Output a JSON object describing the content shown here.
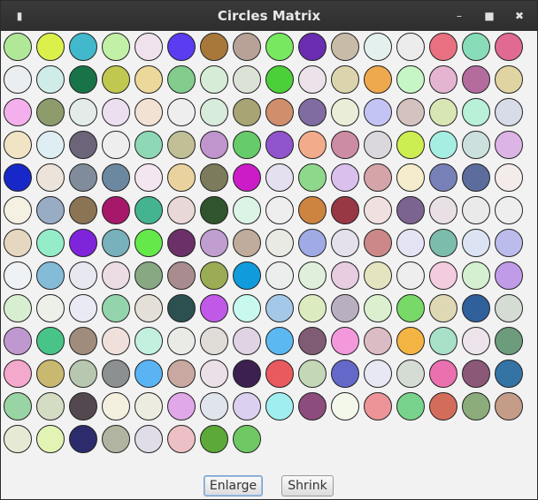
{
  "window": {
    "title": "Circles Matrix"
  },
  "titlebar_icons": {
    "menu": "▮",
    "minimize": "–",
    "maximize": "■",
    "close": "✖"
  },
  "buttons": {
    "enlarge": "Enlarge",
    "shrink": "Shrink"
  },
  "circle_colors": [
    [
      "#b0e898",
      "#dcf04c",
      "#42b8cc",
      "#c2f0a6",
      "#efe2ec",
      "#5b3cf0",
      "#a8783a",
      "#b8a298",
      "#78e860",
      "#6a2cb0",
      "#c8bca8",
      "#e4f0ee",
      "#ececec",
      "#e87080",
      "#88dcb8",
      "#e06a92"
    ],
    [
      "#eaeef0",
      "#d0ece8",
      "#187448",
      "#c0c850",
      "#ecd89a",
      "#82cc8e",
      "#d6ecd6",
      "#dce2d6",
      "#4cd03a",
      "#ece2ea",
      "#dcd4ac",
      "#eea84e",
      "#c6f6c6",
      "#e4b4d0",
      "#b46c9e",
      "#e0d4a2"
    ],
    [
      "#f4b0ec",
      "#8e9c6c",
      "#e4ecea",
      "#ece0f0",
      "#f2e2d4",
      "#eeeeee",
      "#d8ecdc",
      "#a8a474",
      "#d08e6c",
      "#806ca0",
      "#eaeed8",
      "#c4c4f4",
      "#d4c2be",
      "#d8e6b4",
      "#b8f0d8",
      "#d8dce8"
    ],
    [
      "#f0e4c4",
      "#deeef2",
      "#6c6478",
      "#eeeeee",
      "#8ed8b6",
      "#c0bf96",
      "#c094cc",
      "#66cc6a",
      "#9054cc",
      "#f2ac8c",
      "#cc8ca4",
      "#dad8dc",
      "#cdee52",
      "#a6eee2",
      "#cce0de",
      "#dcb4e6"
    ],
    [
      "#1828c8",
      "#ece4da",
      "#808c9c",
      "#6c88a0",
      "#f4e6f0",
      "#ead29e",
      "#7c7c5c",
      "#cc1cc8",
      "#e4e0f0",
      "#8ed88c",
      "#dac0ec",
      "#d4a4a8",
      "#f4eccc",
      "#7880b8",
      "#5c6c9c",
      "#f4ecea"
    ],
    [
      "#f4f0e2",
      "#98acc4",
      "#8a7454",
      "#a8186a",
      "#44b490",
      "#e8d8d8",
      "#30542c",
      "#dcf4e6",
      "#eeeeee",
      "#cc8440",
      "#983844",
      "#f0e0e0",
      "#7c6490",
      "#e8e0e4",
      "#eaeaea",
      "#eeeeee"
    ],
    [
      "#e6d8c0",
      "#94ecc8",
      "#8024dc",
      "#78b0bc",
      "#64e84a",
      "#6c3068",
      "#c09ed0",
      "#c0ac9c",
      "#eaeae4",
      "#a0aae4",
      "#e4e0ec",
      "#cc8888",
      "#e4e4f4",
      "#7cbcac",
      "#dce4f4",
      "#bcbcec"
    ],
    [
      "#eef2f4",
      "#84bcd8",
      "#e8e8f0",
      "#ecdce4",
      "#88a884",
      "#a88c90",
      "#9cac54",
      "#109cdc",
      "#eceeee",
      "#e0eedc",
      "#e8cce0",
      "#e4e4c0",
      "#eeeeee",
      "#f4cce0",
      "#d4f0d0",
      "#c09ce8"
    ],
    [
      "#d8eed0",
      "#ecf0e8",
      "#eaeaf4",
      "#94d4ac",
      "#e4e0d8",
      "#2c5050",
      "#c058e8",
      "#c8f8ee",
      "#a4c8e8",
      "#dcecc0",
      "#b8b0c0",
      "#dcf0d0",
      "#78d868",
      "#ded8b4",
      "#30609c",
      "#d4dcd4"
    ],
    [
      "#c098d0",
      "#48c488",
      "#a08c7c",
      "#f0e0dc",
      "#c4f0e0",
      "#eaeae6",
      "#e0dcd8",
      "#e0d4e4",
      "#5cb8f0",
      "#805c74",
      "#f498dc",
      "#dcbcc4",
      "#f4b444",
      "#a8e0c8",
      "#ece4ea",
      "#6c9c7c"
    ],
    [
      "#f4a8cc",
      "#c8b870",
      "#b8c8b0",
      "#8c9090",
      "#5ab4f4",
      "#c8a8a0",
      "#ece0e8",
      "#3c2050",
      "#e85a5e",
      "#c4d8b8",
      "#6468c8",
      "#e8e8f4",
      "#d4dcd4",
      "#ea70b0",
      "#8c5878",
      "#3474a4"
    ],
    [
      "#98d4a4",
      "#d4dcc4",
      "#544850",
      "#f4f0e0",
      "#ecece0",
      "#e0a8e8",
      "#e0e4ec",
      "#dcd0f0",
      "#a0eef0",
      "#8c4c7c",
      "#f4f8ea",
      "#ec9498",
      "#78d48c",
      "#d46c5c",
      "#8cac7c",
      "#c49c88"
    ],
    [
      "#e6ead4",
      "#e2f4b4",
      "#2c2c6c",
      "#b0b4a0",
      "#e0dce8",
      "#ecc0c4",
      "#5ca838",
      "#70c864"
    ]
  ]
}
